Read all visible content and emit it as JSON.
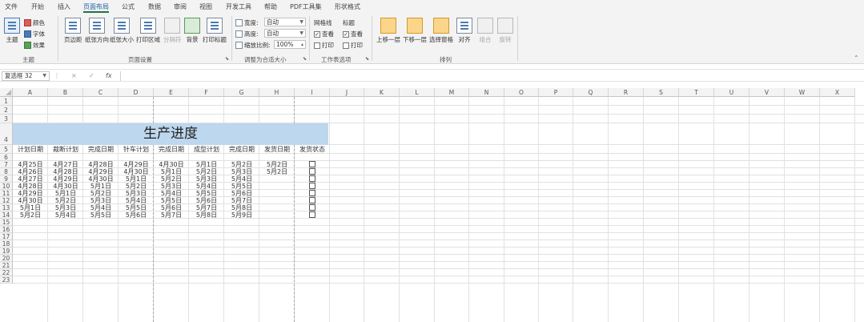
{
  "menu": {
    "tabs": [
      "文件",
      "开始",
      "插入",
      "页面布局",
      "公式",
      "数据",
      "审阅",
      "视图",
      "开发工具",
      "帮助",
      "PDF工具集",
      "形状格式"
    ],
    "active_index": 3
  },
  "ribbon": {
    "theme": {
      "big_label": "主题",
      "colors_label": "颜色",
      "fonts_label": "字体",
      "effects_label": "效果",
      "group_label": "主题"
    },
    "page_setup": {
      "buttons": [
        "页边距",
        "纸张方向",
        "纸张大小",
        "打印区域",
        "分隔符",
        "背景",
        "打印标题"
      ],
      "group_label": "页面设置"
    },
    "scale_to_fit": {
      "width_label": "宽度:",
      "width_value": "自动",
      "height_label": "高度:",
      "height_value": "自动",
      "scale_label": "缩放比例:",
      "scale_value": "100%",
      "group_label": "调整为合适大小"
    },
    "sheet_options": {
      "gridlines_label": "网格线",
      "headings_label": "标题",
      "view_label": "查看",
      "print_label": "打印",
      "group_label": "工作表选项"
    },
    "arrange": {
      "buttons": [
        "上移一层",
        "下移一层",
        "选择窗格",
        "对齐",
        "组合",
        "旋转"
      ],
      "group_label": "排列"
    },
    "collapse_icon": "chevron-up-icon"
  },
  "formula_bar": {
    "name_box": "复选框 32",
    "cancel_icon": "×",
    "enter_icon": "✓",
    "fx_label": "fx",
    "value": ""
  },
  "grid": {
    "columns": [
      "A",
      "B",
      "C",
      "D",
      "E",
      "F",
      "G",
      "H",
      "I",
      "J",
      "K",
      "L",
      "M",
      "N",
      "O",
      "P",
      "Q",
      "R",
      "S",
      "T",
      "U",
      "V",
      "W",
      "X"
    ],
    "rows": [
      "1",
      "2",
      "3",
      "4",
      "5",
      "6",
      "7",
      "8",
      "9",
      "10",
      "11",
      "12",
      "13",
      "14",
      "15",
      "16",
      "17",
      "18",
      "19",
      "20",
      "21",
      "22",
      "23"
    ]
  },
  "sheet": {
    "title": "生产进度",
    "headers": [
      "计划日期",
      "裁断计划",
      "完成日期",
      "针车计划",
      "完成日期",
      "成型计划",
      "完成日期",
      "发货日期",
      "发货状态"
    ],
    "rows": [
      [
        "4月25日",
        "4月27日",
        "4月28日",
        "4月29日",
        "4月30日",
        "5月1日",
        "5月2日",
        "5月2日"
      ],
      [
        "4月26日",
        "4月28日",
        "4月29日",
        "4月30日",
        "5月1日",
        "5月2日",
        "5月3日",
        "5月2日"
      ],
      [
        "4月27日",
        "4月29日",
        "4月30日",
        "5月1日",
        "5月2日",
        "5月3日",
        "5月4日",
        ""
      ],
      [
        "4月28日",
        "4月30日",
        "5月1日",
        "5月2日",
        "5月3日",
        "5月4日",
        "5月5日",
        ""
      ],
      [
        "4月29日",
        "5月1日",
        "5月2日",
        "5月3日",
        "5月4日",
        "5月5日",
        "5月6日",
        ""
      ],
      [
        "4月30日",
        "5月2日",
        "5月3日",
        "5月4日",
        "5月5日",
        "5月6日",
        "5月7日",
        ""
      ],
      [
        "5月1日",
        "5月3日",
        "5月4日",
        "5月5日",
        "5月6日",
        "5月7日",
        "5月8日",
        ""
      ],
      [
        "5月2日",
        "5月4日",
        "5月5日",
        "5月6日",
        "5月7日",
        "5月8日",
        "5月9日",
        ""
      ]
    ]
  },
  "colors": {
    "accent_green": "#217346",
    "title_band": "#bdd7ee",
    "active_tab_text": "#1f5fa8"
  }
}
